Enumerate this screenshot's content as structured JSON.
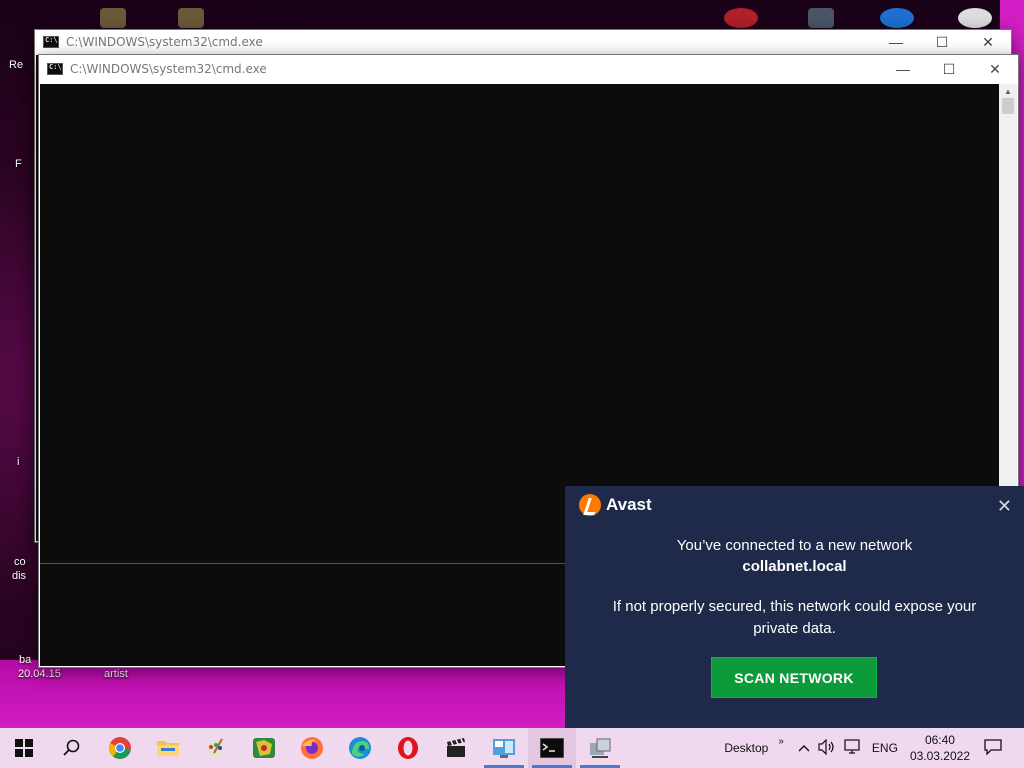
{
  "desktop": {
    "fragments": [
      "Re",
      "F",
      "i",
      "co",
      "dis",
      "ba",
      "20.04.15",
      "artist"
    ]
  },
  "windows": [
    {
      "title": "C:\\WINDOWS\\system32\\cmd.exe",
      "state": "background"
    },
    {
      "title": "C:\\WINDOWS\\system32\\cmd.exe",
      "state": "foreground"
    }
  ],
  "window_controls": {
    "minimize": "—",
    "maximize": "☐",
    "close": "✕"
  },
  "notification": {
    "brand": "Avast",
    "line1": "You’ve connected to a new network",
    "network": "collabnet.local",
    "message": "If not properly secured, this network could expose your private data.",
    "button": "SCAN NETWORK",
    "colors": {
      "background": "#1f2a4a",
      "button": "#0c9a3a",
      "logo": "#ff7800"
    }
  },
  "taskbar": {
    "items": [
      {
        "name": "start",
        "icon": "windows-icon"
      },
      {
        "name": "search",
        "icon": "search-icon"
      },
      {
        "name": "chrome",
        "icon": "chrome-icon"
      },
      {
        "name": "file-explorer",
        "icon": "folder-icon"
      },
      {
        "name": "paint",
        "icon": "paint-icon"
      },
      {
        "name": "maps",
        "icon": "map-icon"
      },
      {
        "name": "firefox",
        "icon": "firefox-icon"
      },
      {
        "name": "edge",
        "icon": "edge-icon"
      },
      {
        "name": "opera",
        "icon": "opera-icon"
      },
      {
        "name": "video-editor",
        "icon": "clapperboard-icon"
      },
      {
        "name": "control-panel",
        "icon": "control-panel-icon"
      },
      {
        "name": "cmd",
        "icon": "cmd-icon"
      },
      {
        "name": "remote",
        "icon": "network-tool-icon"
      }
    ],
    "desktop_label": "Desktop",
    "tray_overflow": "»",
    "language": "ENG",
    "time": "06:40",
    "date": "03.03.2022"
  }
}
